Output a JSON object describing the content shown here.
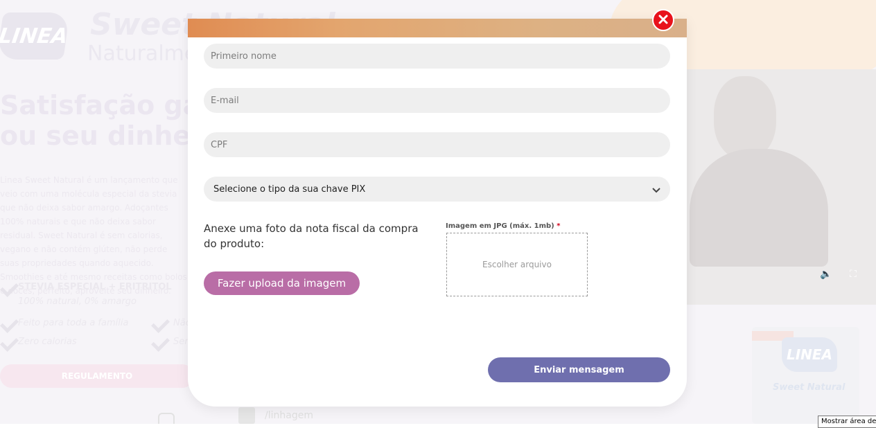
{
  "background": {
    "brand_logo": "LINEA",
    "sweet_title": "Sweet Natural",
    "natural_sub": "Naturalmente",
    "headline_line1": "Satisfação garantida",
    "headline_line2": "ou seu dinheiro de volta",
    "paragraph": "Linea Sweet Natural é um lançamento que veio com uma molécula especial da stevia que não deixa sabor amargo. Adoçantes 100% naturais e que não deixa sabor residual. Sweet Natural é sem calorias, vegano e não contém glúten, não perde suas propriedades quando aquecido. Smoothies e até mesmo receitas como bolos e doces, perfeito, aproveite seu dinheiro.",
    "feature_1": "STEVIA ESPECIAL + ERITRITOL",
    "feature_1_sub": "100% natural, 0% amargo",
    "feature_2": "Feito para toda a família",
    "feature_3": "Zero calorias",
    "feature_4": "Não contém glúten",
    "feature_5": "Sem sabor residual",
    "regulation_button": "REGULAMENTO",
    "social_handle": "/linhagem",
    "product_brand": "LINEA",
    "product_name": "Sweet Natural",
    "video_volume_icon": "volume-icon",
    "video_fullscreen_icon": "fullscreen-icon"
  },
  "modal": {
    "close_icon": "close-icon",
    "fields": {
      "first_name_placeholder": "Primeiro nome",
      "email_placeholder": "E-mail",
      "cpf_placeholder": "CPF"
    },
    "pix_select": {
      "selected": "Selecione o tipo da sua chave PIX",
      "icon": "chevron-down-icon"
    },
    "upload": {
      "label": "Anexe uma foto da nota fiscal da compra do produto:",
      "button": "Fazer upload da imagem",
      "file_label": "Imagem em JPG (máx. 1mb)",
      "required_mark": "*",
      "choose_file": "Escolher arquivo"
    },
    "submit_button": "Enviar mensagem"
  },
  "tooltip": "Mostrar área de",
  "colors": {
    "header_gradient_start": "#e08c52",
    "header_gradient_end": "#d9b08a",
    "upload_button": "#b96da6",
    "submit_button": "#6f6fae",
    "close_button": "#e8121b",
    "field_background": "#efefef"
  }
}
